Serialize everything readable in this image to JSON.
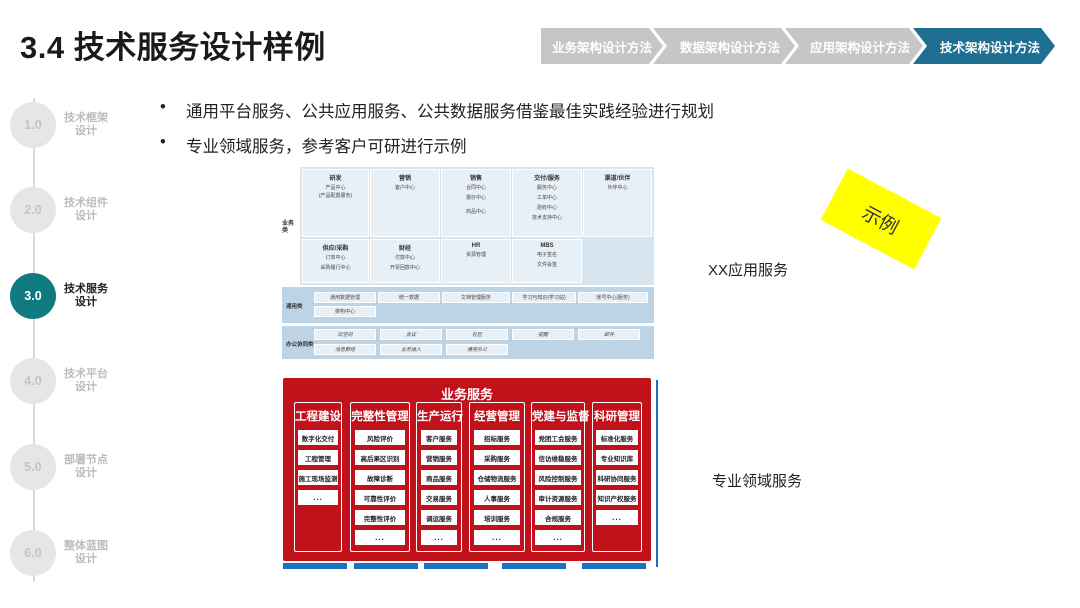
{
  "title": "3.4 技术服务设计样例",
  "nav": [
    "业务架构设计方法",
    "数据架构设计方法",
    "应用架构设计方法",
    "技术架构设计方法"
  ],
  "nav_active": 3,
  "steps": [
    {
      "num": "1.0",
      "label": "技术框架设计",
      "active": false
    },
    {
      "num": "2.0",
      "label": "技术组件设计",
      "active": false
    },
    {
      "num": "3.0",
      "label": "技术服务设计",
      "active": true
    },
    {
      "num": "4.0",
      "label": "技术平台设计",
      "active": false
    },
    {
      "num": "5.0",
      "label": "部署节点设计",
      "active": false
    },
    {
      "num": "6.0",
      "label": "整体蓝图设计",
      "active": false
    }
  ],
  "bullets": [
    "通用平台服务、公共应用服务、公共数据服务借鉴最佳实践经验进行规划",
    "专业领域服务，参考客户可研进行示例"
  ],
  "bullet_dot": "•",
  "sticky_note": "示例",
  "label_app": "XX应用服务",
  "label_pro": "专业领域服务",
  "app_diagram": {
    "biz_category": "业务类",
    "top_row": [
      {
        "title": "研发",
        "items": [
          "产品中心",
          "(产品配置服务)"
        ]
      },
      {
        "title": "营销",
        "items": [
          "客户中心"
        ]
      },
      {
        "title": "销售",
        "items": [
          "合同中心",
          "报价中心",
          "",
          "商品中心"
        ]
      },
      {
        "title": "交付/服务",
        "items": [
          "服务中心",
          "工单中心",
          "验收中心",
          "技术支持中心"
        ]
      },
      {
        "title": "渠道/伙伴",
        "items": [
          "伙伴中心"
        ]
      }
    ],
    "bottom_row": [
      {
        "title": "供应/采购",
        "items": [
          "订单中心",
          "采购履行中心"
        ]
      },
      {
        "title": "财经",
        "items": [
          "付款中心",
          "开票回款中心"
        ]
      },
      {
        "title": "HR",
        "items": [
          "资源管理"
        ]
      },
      {
        "title": "MBS",
        "items": [
          "电子签名",
          "文件会签"
        ]
      }
    ],
    "general_band": {
      "title": "通用类",
      "items": [
        "通用数据管理",
        "统一数据",
        "文档管理服务",
        "学习与知识(学习站)",
        "账号中心(服务)",
        "架构中心"
      ]
    },
    "office_band": {
      "title": "办公协同类",
      "items": [
        "云空间",
        "会议",
        "社区",
        "提醒",
        "邮件",
        "消息群组",
        "业务插入",
        "通用办公"
      ]
    }
  },
  "biz_services": {
    "title": "业务服务",
    "columns": [
      {
        "title": "工程建设",
        "items": [
          "数字化交付",
          "工程管理",
          "施工现场监测",
          "..."
        ]
      },
      {
        "title": "完整性管理",
        "items": [
          "风险评价",
          "高后果区识别",
          "故障诊断",
          "可靠性评价",
          "完整性评价",
          "..."
        ]
      },
      {
        "title": "生产运行",
        "items": [
          "客户服务",
          "营销服务",
          "商品服务",
          "交易服务",
          "调运服务",
          "..."
        ]
      },
      {
        "title": "经营管理",
        "items": [
          "招标服务",
          "采购服务",
          "仓储物流服务",
          "人事服务",
          "培训服务",
          "..."
        ]
      },
      {
        "title": "党建与监督",
        "items": [
          "党团工会服务",
          "信访维稳服务",
          "风险控制服务",
          "审计资源服务",
          "合规服务",
          "..."
        ]
      },
      {
        "title": "科研管理",
        "items": [
          "标准化服务",
          "专业知识库",
          "科研协同服务",
          "知识产权服务",
          "..."
        ]
      }
    ]
  },
  "colors": {
    "accent": "#1f6f93",
    "teal": "#0f7b80",
    "red": "#c1121c",
    "blue": "#1f6fbf",
    "sticky": "#ffff00"
  }
}
